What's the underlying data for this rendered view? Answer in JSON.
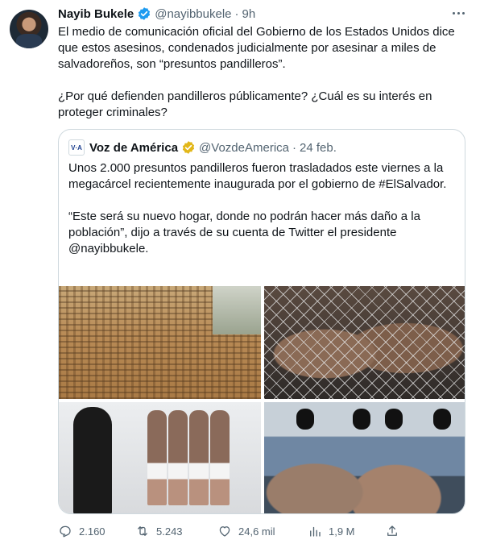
{
  "tweet": {
    "author_name": "Nayib Bukele",
    "handle": "@nayibbukele",
    "separator": "·",
    "time": "9h",
    "paragraphs": [
      "El medio de comunicación oficial del Gobierno de los Estados Unidos dice que estos asesinos, condenados judicialmente por asesinar a miles de salvadoreños, son “presuntos pandilleros”.",
      "¿Por qué defienden pandilleros públicamente? ¿Cuál es su interés en proteger criminales?"
    ]
  },
  "quoted_tweet": {
    "logo_text": "V·A",
    "author_name": "Voz de América",
    "handle": "@VozdeAmerica",
    "separator": "·",
    "date": "24 feb.",
    "paragraphs": [
      "Unos 2.000 presuntos pandilleros fueron trasladados este viernes a la megacárcel recientemente inaugurada por el gobierno de #ElSalvador.",
      "“Este será su nuevo hogar, donde no podrán hacer más daño a la población”, dijo a través de su cuenta de Twitter el presidente @nayibbukele."
    ]
  },
  "actions": {
    "replies": "2.160",
    "retweets": "5.243",
    "likes": "24,6 mil",
    "views": "1,9 M"
  },
  "colors": {
    "text": "#0f1419",
    "secondary": "#536471",
    "border": "#cfd9de",
    "verified_blue": "#1d9bf0",
    "verified_gold": "#e2b719"
  },
  "icons": [
    "verified-badge-icon",
    "more-options-icon",
    "reply-icon",
    "retweet-icon",
    "like-icon",
    "views-icon",
    "share-icon"
  ]
}
